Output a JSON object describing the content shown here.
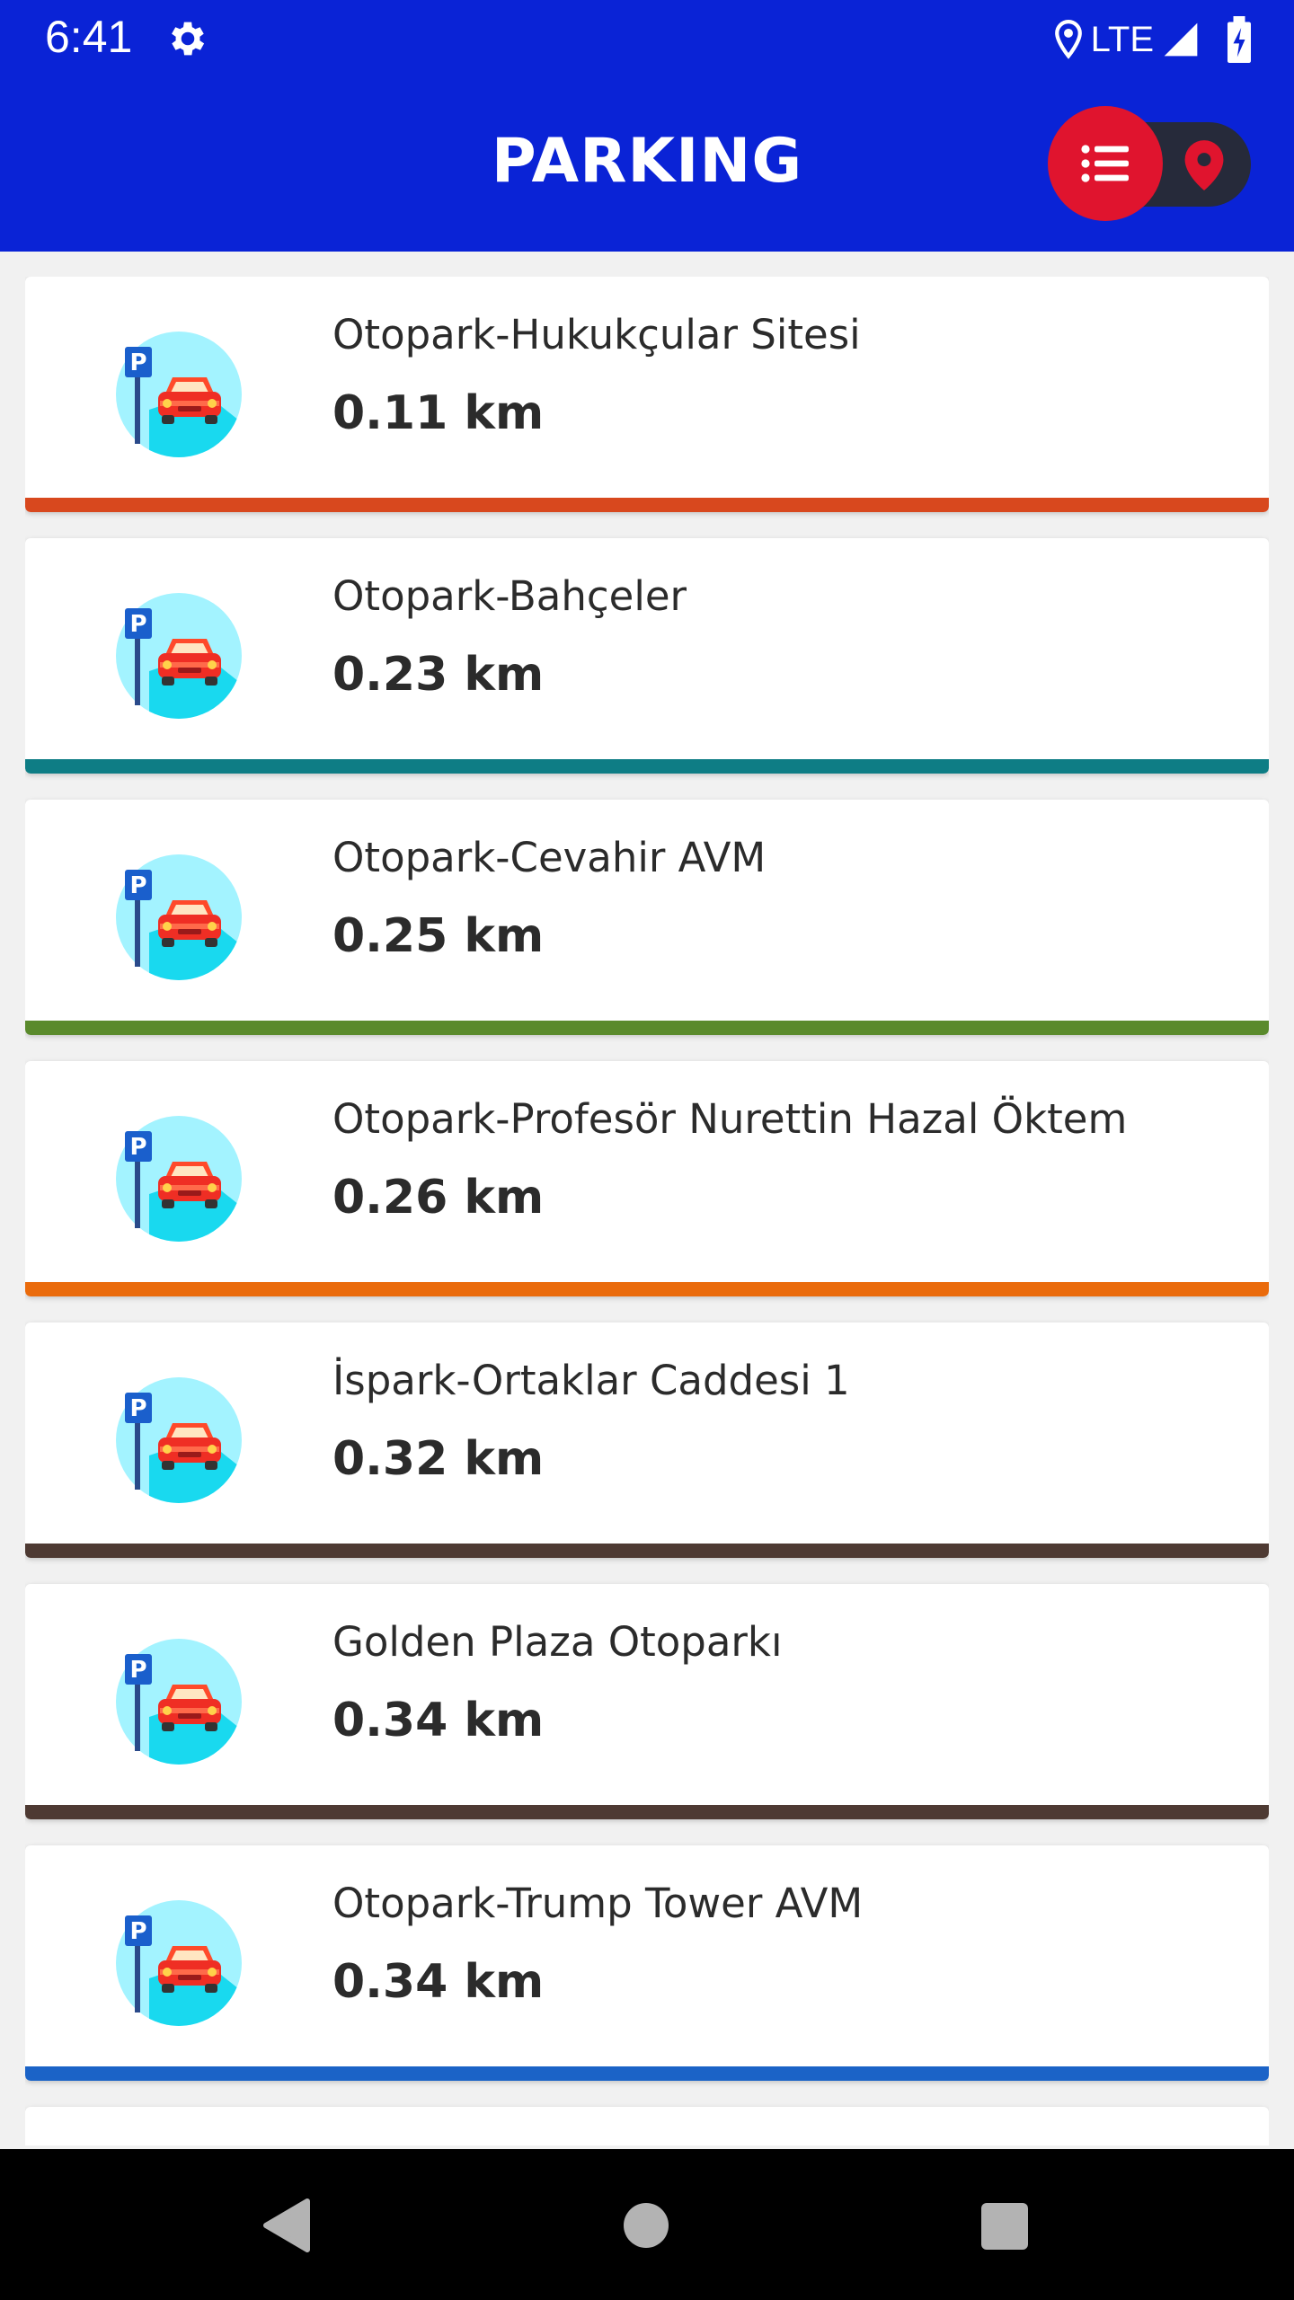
{
  "status_bar": {
    "time": "6:41",
    "network": "LTE",
    "icons": [
      "settings-gear-icon",
      "location-pin-icon",
      "signal-icon",
      "battery-charging-icon"
    ]
  },
  "header": {
    "title": "PARKING",
    "toggle": {
      "active": "list",
      "options": [
        "list-icon",
        "map-pin-icon"
      ]
    }
  },
  "colors": {
    "header_bg": "#0a23d6",
    "toggle_active": "#e0142e",
    "toggle_track": "#262a3a"
  },
  "parkings": [
    {
      "name": "Otopark-Hukukçular Sitesi",
      "distance": "0.11 km",
      "bar_color": "#d8481e"
    },
    {
      "name": "Otopark-Bahçeler",
      "distance": "0.23 km",
      "bar_color": "#0e7d85"
    },
    {
      "name": "Otopark-Cevahir AVM",
      "distance": "0.25 km",
      "bar_color": "#5a8a2c"
    },
    {
      "name": "Otopark-Profesör Nurettin Hazal Öktem",
      "distance": "0.26 km",
      "bar_color": "#ea6b0c"
    },
    {
      "name": "İspark-Ortaklar Caddesi 1",
      "distance": "0.32 km",
      "bar_color": "#4e3a33"
    },
    {
      "name": "Golden Plaza Otoparkı",
      "distance": "0.34 km",
      "bar_color": "#4e3a33"
    },
    {
      "name": "Otopark-Trump Tower AVM",
      "distance": "0.34 km",
      "bar_color": "#1b63c7"
    }
  ]
}
